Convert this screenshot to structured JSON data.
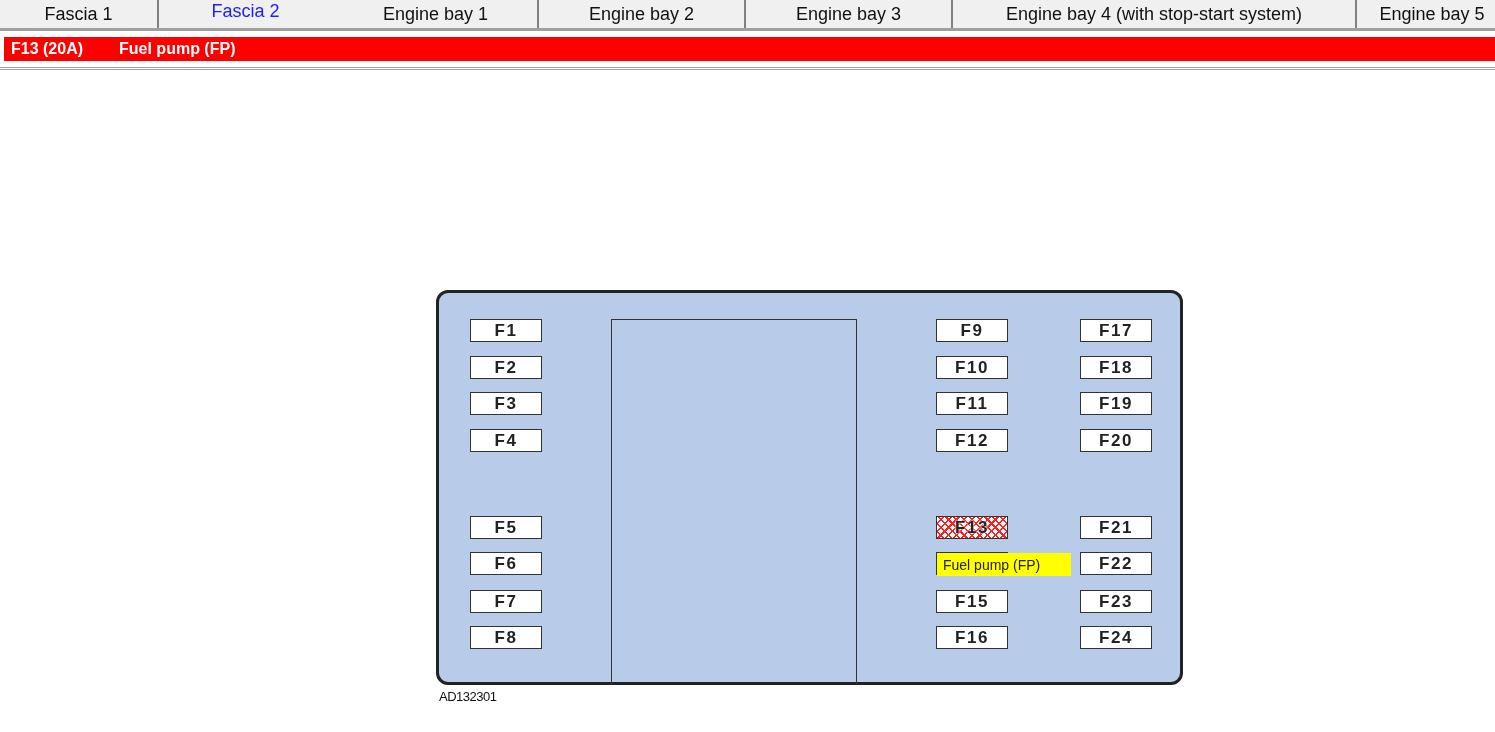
{
  "tabs": [
    {
      "label": "Fascia 1",
      "selected": false
    },
    {
      "label": "Fascia 2",
      "selected": true
    },
    {
      "label": "Engine bay 1",
      "selected": false
    },
    {
      "label": "Engine bay 2",
      "selected": false
    },
    {
      "label": "Engine bay 3",
      "selected": false
    },
    {
      "label": "Engine bay 4 (with stop-start system)",
      "selected": false
    },
    {
      "label": "Engine bay 5",
      "selected": false
    }
  ],
  "selected_fuse": {
    "rating": "F13 (20A)",
    "circuit": "Fuel pump (FP)"
  },
  "fuse_box": {
    "columns": [
      [
        {
          "label": "F1",
          "selected": false
        },
        {
          "label": "F2",
          "selected": false
        },
        {
          "label": "F3",
          "selected": false
        },
        {
          "label": "F4",
          "selected": false
        },
        {
          "label": "F5",
          "selected": false
        },
        {
          "label": "F6",
          "selected": false
        },
        {
          "label": "F7",
          "selected": false
        },
        {
          "label": "F8",
          "selected": false
        }
      ],
      [
        {
          "label": "F9",
          "selected": false
        },
        {
          "label": "F10",
          "selected": false
        },
        {
          "label": "F11",
          "selected": false
        },
        {
          "label": "F12",
          "selected": false
        },
        {
          "label": "F13",
          "selected": true
        },
        {
          "tooltip": "Fuel pump (FP)"
        },
        {
          "label": "F15",
          "selected": false
        },
        {
          "label": "F16",
          "selected": false
        }
      ],
      [
        {
          "label": "F17",
          "selected": false
        },
        {
          "label": "F18",
          "selected": false
        },
        {
          "label": "F19",
          "selected": false
        },
        {
          "label": "F20",
          "selected": false
        },
        {
          "label": "F21",
          "selected": false
        },
        {
          "label": "F22",
          "selected": false
        },
        {
          "label": "F23",
          "selected": false
        },
        {
          "label": "F24",
          "selected": false
        }
      ]
    ],
    "figure_code": "AD132301"
  }
}
